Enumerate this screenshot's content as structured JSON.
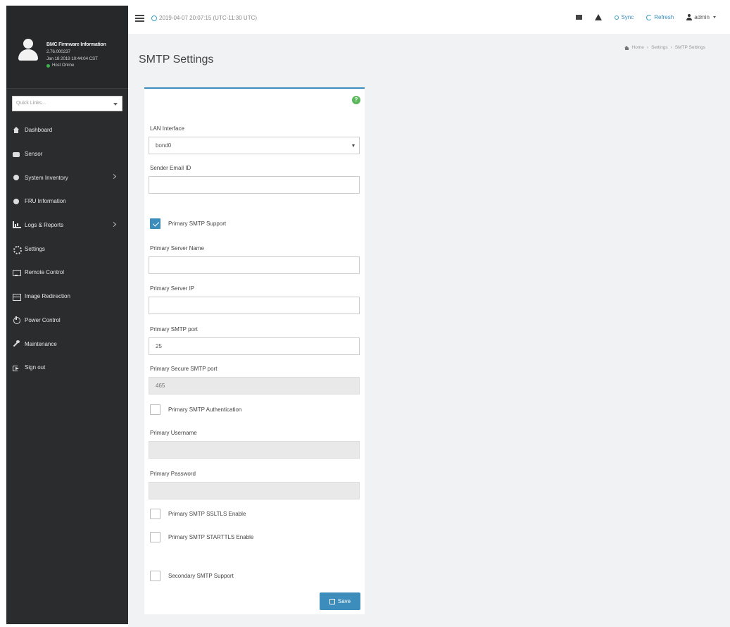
{
  "sidebar": {
    "fw_title": "BMC Firmware Information",
    "fw_version": "2.76.000237",
    "fw_date": "Jan 18 2019 10:44:04 CST",
    "host_status": "Host Online",
    "quick_links_placeholder": "Quick Links...",
    "items": [
      {
        "label": "Dashboard",
        "icon": "home-icon"
      },
      {
        "label": "Sensor",
        "icon": "sensor-icon"
      },
      {
        "label": "System Inventory",
        "icon": "info-icon"
      },
      {
        "label": "FRU Information",
        "icon": "info-icon"
      },
      {
        "label": "Logs & Reports",
        "icon": "chart-icon"
      },
      {
        "label": "Settings",
        "icon": "gear-icon"
      },
      {
        "label": "Remote Control",
        "icon": "monitor-icon"
      },
      {
        "label": "Image Redirection",
        "icon": "disk-icon"
      },
      {
        "label": "Power Control",
        "icon": "power-icon"
      },
      {
        "label": "Maintenance",
        "icon": "wrench-icon"
      },
      {
        "label": "Sign out",
        "icon": "signout-icon"
      }
    ]
  },
  "topbar": {
    "datetime": "2019-04-07 20:07:15 (UTC-11:30 UTC)",
    "sync_label": "Sync",
    "refresh_label": "Refresh",
    "user_label": "admin"
  },
  "page": {
    "title": "SMTP Settings",
    "breadcrumb": {
      "home": "Home",
      "settings": "Settings",
      "current": "SMTP Settings"
    }
  },
  "form": {
    "lan_interface_label": "LAN Interface",
    "lan_interface_value": "bond0",
    "sender_email_label": "Sender Email ID",
    "sender_email_value": "",
    "primary_smtp_support_label": "Primary SMTP Support",
    "primary_smtp_support_checked": true,
    "primary_server_name_label": "Primary Server Name",
    "primary_server_name_value": "",
    "primary_server_ip_label": "Primary Server IP",
    "primary_server_ip_value": "",
    "primary_smtp_port_label": "Primary SMTP port",
    "primary_smtp_port_value": "25",
    "primary_secure_smtp_port_label": "Primary Secure SMTP port",
    "primary_secure_smtp_port_value": "465",
    "primary_smtp_auth_label": "Primary SMTP Authentication",
    "primary_username_label": "Primary Username",
    "primary_password_label": "Primary Password",
    "primary_ssltls_label": "Primary SMTP SSLTLS Enable",
    "primary_starttls_label": "Primary SMTP STARTTLS Enable",
    "secondary_smtp_support_label": "Secondary SMTP Support",
    "save_label": "Save"
  },
  "colors": {
    "accent": "#3c8dbc",
    "sidebar_bg": "#2a2c2e",
    "help": "#5cb85c"
  }
}
